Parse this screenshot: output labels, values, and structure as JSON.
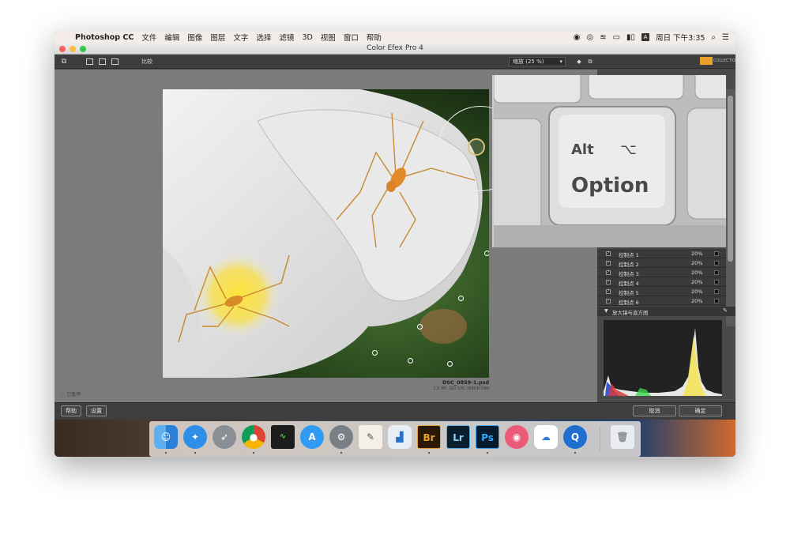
{
  "menubar": {
    "app_name": "Photoshop CC",
    "menus": [
      "文件",
      "编辑",
      "图像",
      "图层",
      "文字",
      "选择",
      "滤镜",
      "3D",
      "视图",
      "窗口",
      "帮助"
    ],
    "clock": "周日 下午3:35",
    "input_badge": "A"
  },
  "window": {
    "title": "Color Efex Pro 4"
  },
  "toolbar": {
    "compare_label": "比较",
    "zoom_label": "缩放 (25 %)"
  },
  "image": {
    "filename": "DSC_0859-1.psd",
    "details": "1.5 MP, ISO 500, NIKON D90"
  },
  "loupe": {
    "key_line1": "Alt",
    "key_line2": "Option",
    "key_symbol": "⌥"
  },
  "control_points": [
    {
      "name": "控制点 1",
      "opacity": "20%"
    },
    {
      "name": "控制点 2",
      "opacity": "20%"
    },
    {
      "name": "控制点 3",
      "opacity": "20%"
    },
    {
      "name": "控制点 4",
      "opacity": "20%"
    },
    {
      "name": "控制点 5",
      "opacity": "20%"
    },
    {
      "name": "控制点 6",
      "opacity": "20%"
    }
  ],
  "histogram": {
    "header_label": "放大镜与直方图"
  },
  "status": {
    "label": "已暂停"
  },
  "bottom": {
    "help_label": "帮助",
    "settings_label": "设置",
    "cancel_label": "取消",
    "ok_label": "确定"
  },
  "dock": {
    "items": [
      {
        "name": "finder",
        "label": ""
      },
      {
        "name": "safari",
        "label": ""
      },
      {
        "name": "launchpad",
        "label": ""
      },
      {
        "name": "chrome",
        "label": ""
      },
      {
        "name": "activity-monitor",
        "label": ""
      },
      {
        "name": "app-store",
        "label": ""
      },
      {
        "name": "system-preferences",
        "label": ""
      },
      {
        "name": "textedit",
        "label": ""
      },
      {
        "name": "keynote",
        "label": ""
      },
      {
        "name": "bridge",
        "label": "Br"
      },
      {
        "name": "lightroom",
        "label": "Lr"
      },
      {
        "name": "photoshop",
        "label": "Ps"
      },
      {
        "name": "weibo",
        "label": ""
      },
      {
        "name": "baidu-netdisk",
        "label": ""
      },
      {
        "name": "quicktime",
        "label": ""
      },
      {
        "name": "trash",
        "label": ""
      }
    ]
  }
}
